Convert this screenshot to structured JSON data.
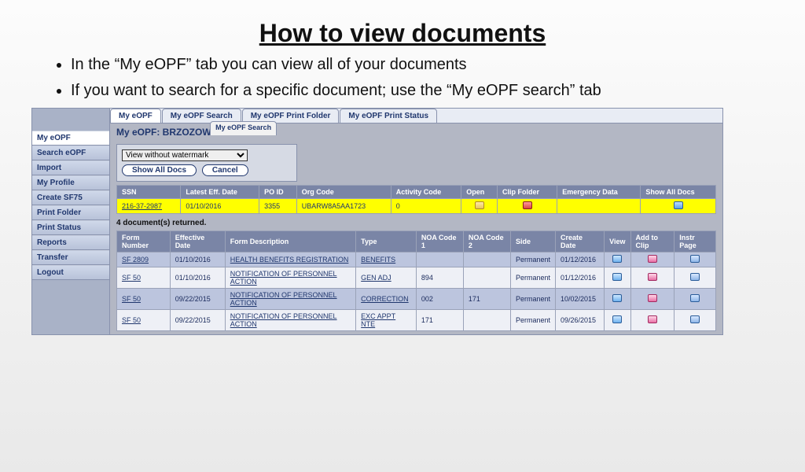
{
  "slide": {
    "title": "How to view documents",
    "bullets": [
      "In the “My eOPF” tab you can view all of your documents",
      "If you want to search for a specific document; use the “My eOPF search” tab"
    ]
  },
  "sidenav": {
    "items": [
      "My eOPF",
      "Search eOPF",
      "Import",
      "My Profile",
      "Create SF75",
      "Print Folder",
      "Print Status",
      "Reports",
      "Transfer",
      "Logout"
    ],
    "selected_index": 0
  },
  "tabs": {
    "items": [
      "My eOPF",
      "My eOPF Search",
      "My eOPF Print Folder",
      "My eOPF Print Status"
    ],
    "selected_index": 0,
    "sub_badge": "My eOPF Search"
  },
  "headline": "My eOPF: BRZOZOW",
  "controls": {
    "watermark_select": "View without watermark",
    "show_all": "Show All Docs",
    "cancel": "Cancel"
  },
  "summary_table": {
    "headers": [
      "SSN",
      "Latest Eff. Date",
      "PO ID",
      "Org Code",
      "Activity Code",
      "Open",
      "Clip Folder",
      "Emergency Data",
      "Show All Docs"
    ],
    "row": {
      "ssn": "216-37-2987",
      "date": "01/10/2016",
      "po": "3355",
      "org": "UBARW8A5AA1723",
      "act": "0"
    }
  },
  "doc_count": "4 document(s) returned.",
  "docs_table": {
    "headers": [
      "Form Number",
      "Effective Date",
      "Form Description",
      "Type",
      "NOA Code 1",
      "NOA Code 2",
      "Side",
      "Create Date",
      "View",
      "Add to Clip",
      "Instr Page"
    ],
    "rows": [
      {
        "form": "SF 2809",
        "date": "01/10/2016",
        "desc": "HEALTH BENEFITS REGISTRATION",
        "type": "BENEFITS",
        "n1": "",
        "n2": "",
        "side": "Permanent",
        "cdate": "01/12/2016"
      },
      {
        "form": "SF 50",
        "date": "01/10/2016",
        "desc": "NOTIFICATION OF PERSONNEL ACTION",
        "type": "GEN ADJ",
        "n1": "894",
        "n2": "",
        "side": "Permanent",
        "cdate": "01/12/2016"
      },
      {
        "form": "SF 50",
        "date": "09/22/2015",
        "desc": "NOTIFICATION OF PERSONNEL ACTION",
        "type": "CORRECTION",
        "n1": "002",
        "n2": "171",
        "side": "Permanent",
        "cdate": "10/02/2015"
      },
      {
        "form": "SF 50",
        "date": "09/22/2015",
        "desc": "NOTIFICATION OF PERSONNEL ACTION",
        "type": "EXC APPT NTE",
        "n1": "171",
        "n2": "",
        "side": "Permanent",
        "cdate": "09/26/2015"
      }
    ]
  }
}
